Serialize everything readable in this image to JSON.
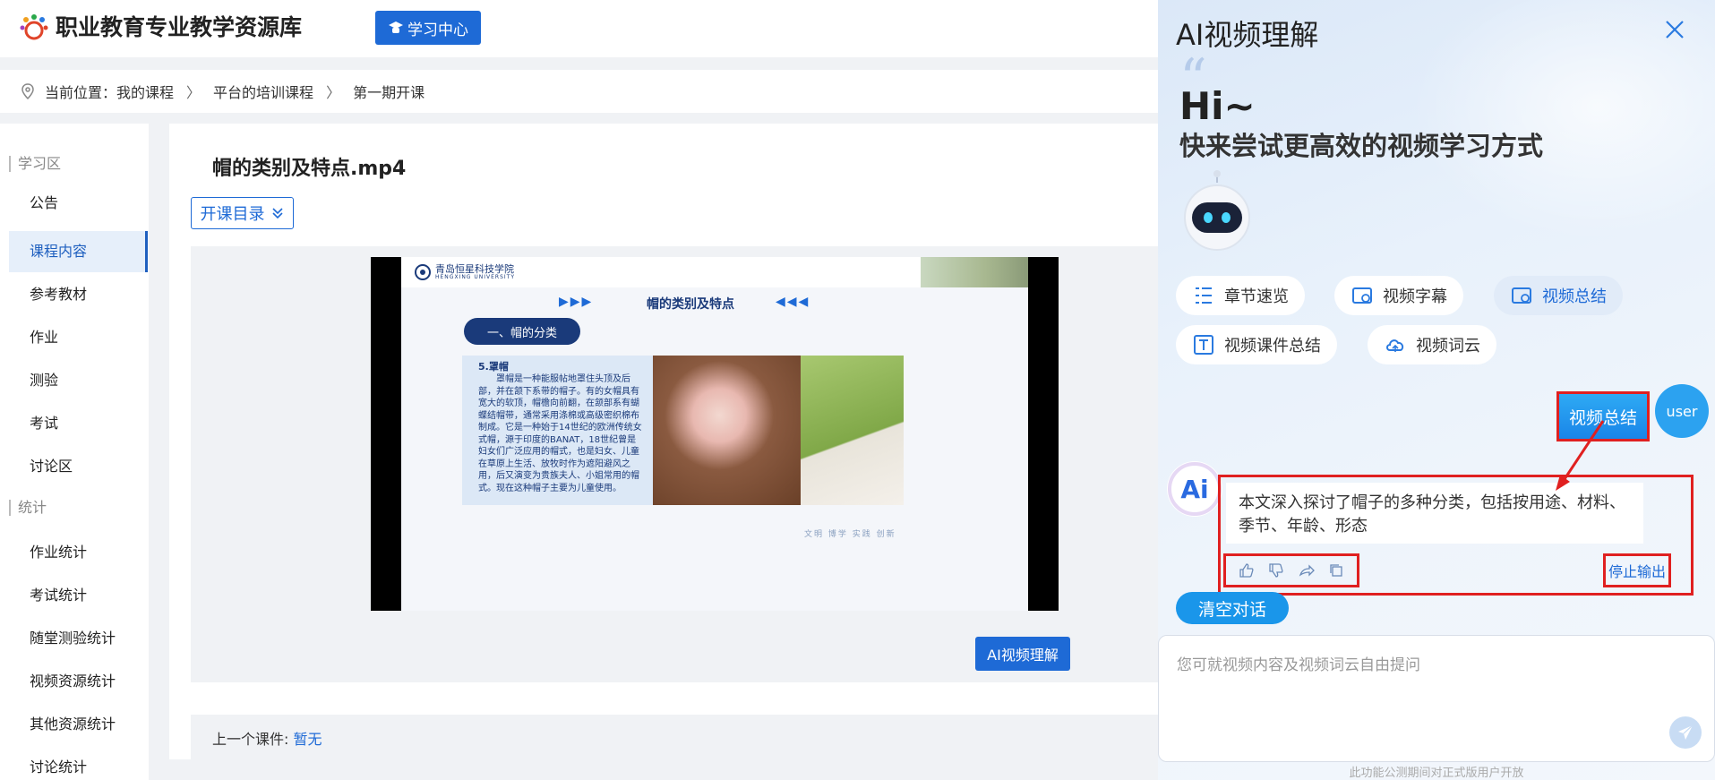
{
  "header": {
    "brand": "职业教育专业教学资源库",
    "study_center": "学习中心"
  },
  "breadcrumb": {
    "prefix": "当前位置：",
    "items": [
      "我的课程",
      "平台的培训课程",
      "第一期开课"
    ]
  },
  "sidebar": {
    "section_learn": "学习区",
    "section_stats": "统计",
    "items": [
      {
        "label": "公告"
      },
      {
        "label": "课程内容",
        "active": true
      },
      {
        "label": "参考教材"
      },
      {
        "label": "作业"
      },
      {
        "label": "测验"
      },
      {
        "label": "考试"
      },
      {
        "label": "讨论区"
      },
      {
        "label": "作业统计"
      },
      {
        "label": "考试统计"
      },
      {
        "label": "随堂测验统计"
      },
      {
        "label": "视频资源统计"
      },
      {
        "label": "其他资源统计"
      },
      {
        "label": "讨论统计"
      }
    ]
  },
  "main": {
    "video_title": "帽的类别及特点.mp4",
    "catalog_label": "开课目录",
    "ai_button": "AI视频理解",
    "prev_label": "上一个课件:",
    "prev_value": "暂无"
  },
  "slide": {
    "school_cn": "青岛恒星科技学院",
    "school_en": "HENGXING UNIVERSITY",
    "title": "帽的类别及特点",
    "section": "一、帽的分类",
    "sub": "5.罩帽",
    "body": "罩帽是一种能服帖地罩住头顶及后部，并在颔下系带的帽子。有的女帽具有宽大的软顶，帽檐向前翻，在颔部系有蝴蝶结帽带，通常采用涤棉或高级密织棉布制成。它是一种始于14世纪的欧洲传统女式帽，源于印度的BANAT，18世纪曾是妇女们广泛应用的帽式，也是妇女、儿童在草原上生活、放牧时作为遮阳避风之用，后又演变为贵族夫人、小姐常用的帽式。现在这种帽子主要为儿童使用。",
    "footer": "文明  博学  实践  创新"
  },
  "panel": {
    "title": "AI视频理解",
    "greeting": "Hi~",
    "slogan": "快来尝试更高效的视频学习方式",
    "chips": [
      {
        "label": "章节速览",
        "icon": "list-icon"
      },
      {
        "label": "视频字幕",
        "icon": "subtitle-icon"
      },
      {
        "label": "视频总结",
        "icon": "summary-icon",
        "selected": true
      },
      {
        "label": "视频课件总结",
        "icon": "text-icon"
      },
      {
        "label": "视频词云",
        "icon": "cloud-icon"
      }
    ],
    "user_message": "视频总结",
    "user_label": "user",
    "ai_response": "本文深入探讨了帽子的多种分类，包括按用途、材料、季节、年龄、形态",
    "stop_output": "停止输出",
    "clear_chat": "清空对话",
    "ask_placeholder": "您可就视频内容及视频词云自由提问",
    "footer_note": "此功能公测期间对正式版用户开放"
  },
  "colors": {
    "primary": "#1e6ad6",
    "highlight": "#e02020",
    "chip_selected_bg": "#e1ebf8"
  }
}
